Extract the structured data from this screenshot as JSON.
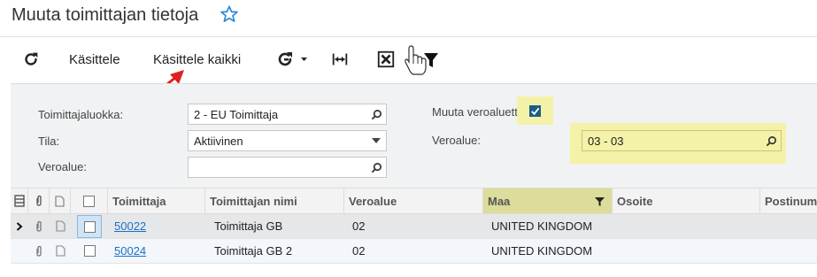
{
  "header": {
    "title": "Muuta toimittajan tietoja"
  },
  "toolbar": {
    "process_label": "Käsittele",
    "process_all_label": "Käsittele kaikki"
  },
  "filters": {
    "vendor_class": {
      "label": "Toimittajaluokka:",
      "value": "2 - EU Toimittaja"
    },
    "status": {
      "label": "Tila:",
      "value": "Aktiivinen"
    },
    "tax_zone": {
      "label": "Veroalue:",
      "value": ""
    },
    "change_tax_zone": {
      "label": "Muuta veroaluetta",
      "checked": true
    },
    "new_tax_zone": {
      "label": "Veroalue:",
      "value": "03 - 03"
    }
  },
  "grid": {
    "columns": [
      "Toimittaja",
      "Toimittajan nimi",
      "Veroalue",
      "Maa",
      "Osoite",
      "Postinum"
    ],
    "rows": [
      {
        "vendor": "50022",
        "name": "Toimittaja GB",
        "tax_zone": "02",
        "country": "UNITED KINGDOM",
        "address": "",
        "postal": ""
      },
      {
        "vendor": "50024",
        "name": "Toimittaja GB 2",
        "tax_zone": "02",
        "country": "UNITED KINGDOM",
        "address": "",
        "postal": ""
      }
    ]
  },
  "colors": {
    "accent": "#1a73c9",
    "highlight": "#f4f2a8",
    "arrow": "#e02020",
    "checkbox": "#1b5e86"
  }
}
